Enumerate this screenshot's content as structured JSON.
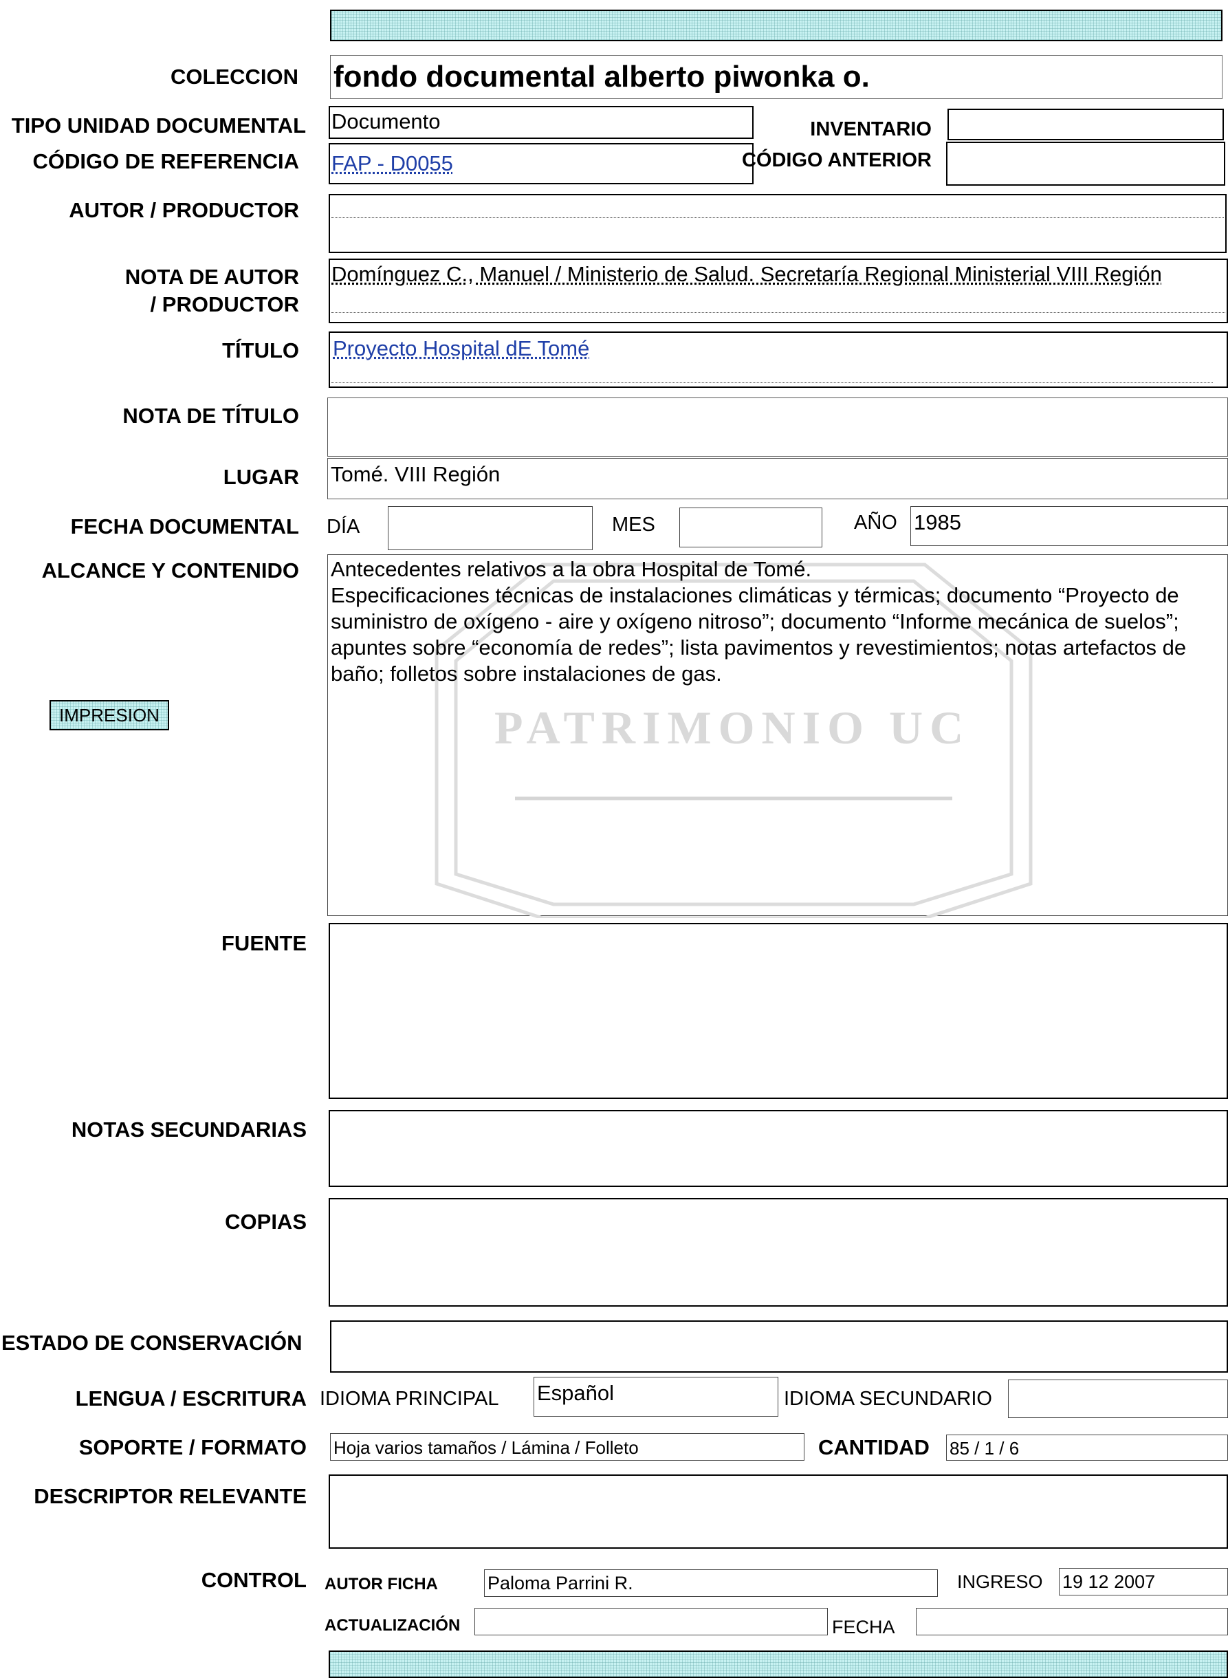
{
  "header_band": "",
  "coleccion": {
    "label": "COLECCION",
    "value": "fondo documental alberto piwonka o."
  },
  "tipo_unidad": {
    "label": "TIPO UNIDAD DOCUMENTAL",
    "value": "Documento"
  },
  "inventario": {
    "label": "INVENTARIO",
    "value": ""
  },
  "codigo_referencia": {
    "label": "CÓDIGO DE REFERENCIA",
    "value": "FAP - D0055"
  },
  "codigo_anterior": {
    "label": "CÓDIGO ANTERIOR",
    "value": ""
  },
  "autor_productor": {
    "label": "AUTOR / PRODUCTOR",
    "value": ""
  },
  "nota_autor": {
    "label_line1": "NOTA DE AUTOR",
    "label_line2": "/ PRODUCTOR",
    "value": "Domínguez C., Manuel / Ministerio de Salud. Secretaría Regional Ministerial VIII Región"
  },
  "titulo": {
    "label": "TÍTULO",
    "value": "Proyecto Hospital dE Tomé"
  },
  "nota_titulo": {
    "label": "NOTA DE TÍTULO",
    "value": ""
  },
  "lugar": {
    "label": "LUGAR",
    "value": "Tomé. VIII Región"
  },
  "fecha_documental": {
    "label": "FECHA DOCUMENTAL",
    "dia_label": "DÍA",
    "dia": "",
    "mes_label": "MES",
    "mes": "",
    "anio_label": "AÑO",
    "anio": "1985"
  },
  "alcance": {
    "label": "ALCANCE Y CONTENIDO",
    "lines": [
      "Antecedentes relativos a la obra Hospital de Tomé.",
      "Especificaciones técnicas de instalaciones climáticas y térmicas; documento “Proyecto de",
      "suministro de oxígeno - aire y oxígeno nitroso”; documento “Informe mecánica de suelos”;",
      "apuntes sobre “economía de redes”; lista pavimentos y revestimientos; notas artefactos de",
      "baño; folletos sobre instalaciones de gas."
    ]
  },
  "impresion_button": "IMPRESION",
  "watermark": "PATRIMONIO UC",
  "fuente": {
    "label": "FUENTE",
    "value": ""
  },
  "notas_secundarias": {
    "label": "NOTAS SECUNDARIAS",
    "value": ""
  },
  "copias": {
    "label": "COPIAS",
    "value": ""
  },
  "estado_conservacion": {
    "label": "ESTADO DE CONSERVACIÓN",
    "value": ""
  },
  "lengua": {
    "label": "LENGUA / ESCRITURA",
    "principal_label": "IDIOMA PRINCIPAL",
    "principal": "Español",
    "secundario_label": "IDIOMA SECUNDARIO",
    "secundario": ""
  },
  "soporte": {
    "label": "SOPORTE / FORMATO",
    "value": "Hoja varios tamaños / Lámina / Folleto",
    "cantidad_label": "CANTIDAD",
    "cantidad": "85 / 1 / 6"
  },
  "descriptor": {
    "label": "DESCRIPTOR RELEVANTE",
    "value": ""
  },
  "control": {
    "label": "CONTROL",
    "autor_ficha_label": "AUTOR FICHA",
    "autor_ficha": "Paloma Parrini R.",
    "ingreso_label": "INGRESO",
    "ingreso": "19 12 2007",
    "actualizacion_label": "ACTUALIZACIÓN",
    "actualizacion": "",
    "fecha_label": "FECHA",
    "fecha": ""
  },
  "footer_band": ""
}
